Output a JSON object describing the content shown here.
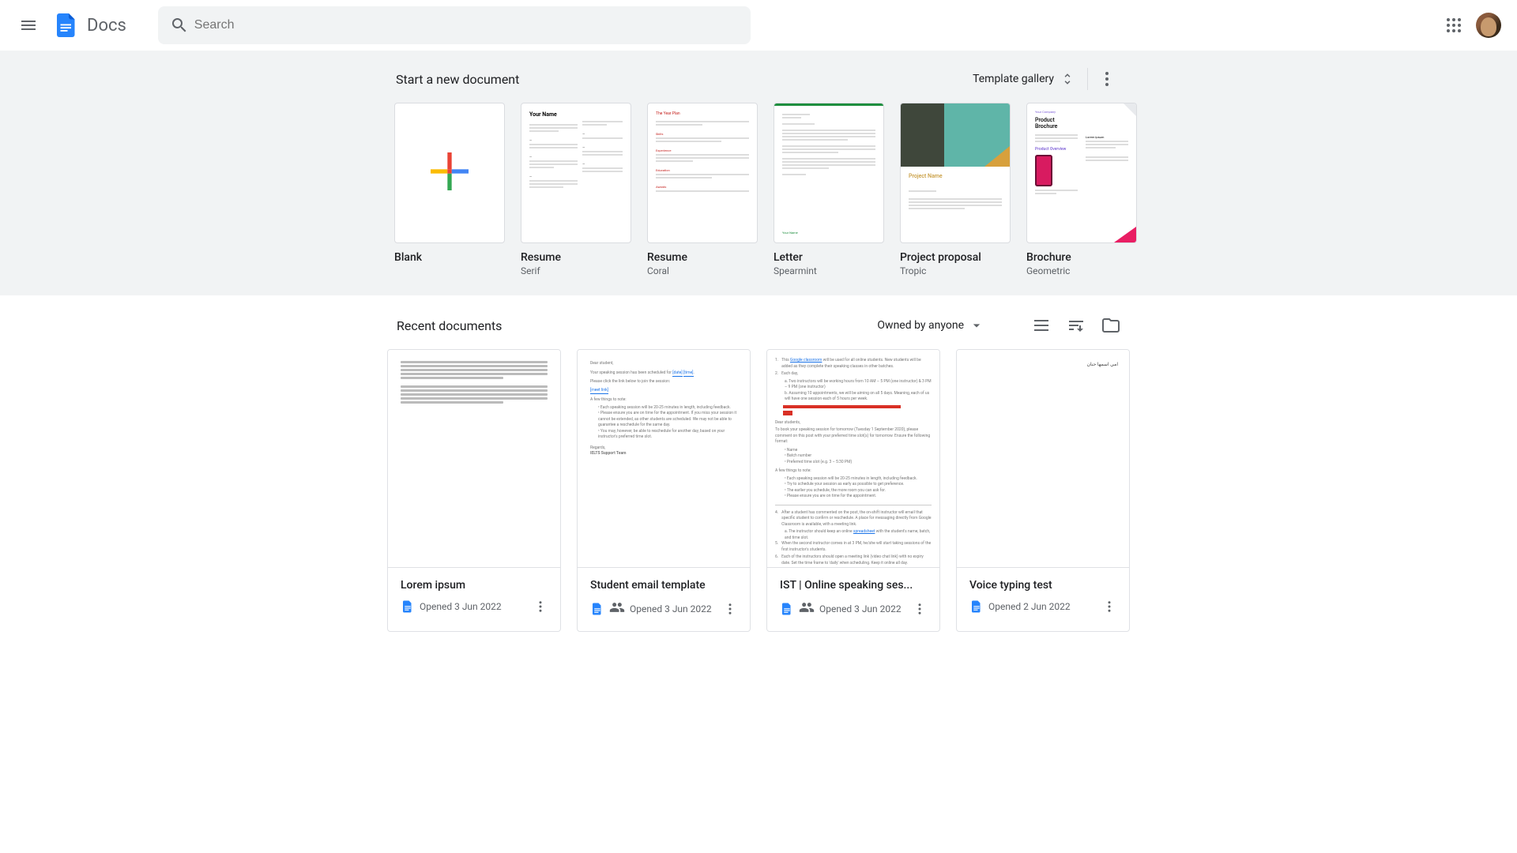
{
  "header": {
    "app_name": "Docs",
    "search_placeholder": "Search"
  },
  "templates": {
    "heading": "Start a new document",
    "gallery_label": "Template gallery",
    "items": [
      {
        "title": "Blank",
        "subtitle": ""
      },
      {
        "title": "Resume",
        "subtitle": "Serif"
      },
      {
        "title": "Resume",
        "subtitle": "Coral"
      },
      {
        "title": "Letter",
        "subtitle": "Spearmint"
      },
      {
        "title": "Project proposal",
        "subtitle": "Tropic"
      },
      {
        "title": "Brochure",
        "subtitle": "Geometric"
      }
    ],
    "preview_text": {
      "serif_name": "Your Name",
      "coral_header": "The Year Plan",
      "tropic_name": "Project Name",
      "brochure_company": "Your Company",
      "brochure_title": "Product Brochure",
      "brochure_overview": "Product Overview",
      "brochure_lorem": "Lorem ipsum"
    }
  },
  "recent": {
    "heading": "Recent documents",
    "owner_filter": "Owned by anyone",
    "docs": [
      {
        "title": "Lorem ipsum",
        "shared": false,
        "date": "Opened 3 Jun 2022"
      },
      {
        "title": "Student email template",
        "shared": true,
        "date": "Opened 3 Jun 2022"
      },
      {
        "title": "IST | Online speaking ses...",
        "shared": true,
        "date": "Opened 3 Jun 2022"
      },
      {
        "title": "Voice typing test",
        "shared": false,
        "date": "Opened 2 Jun 2022"
      }
    ]
  }
}
